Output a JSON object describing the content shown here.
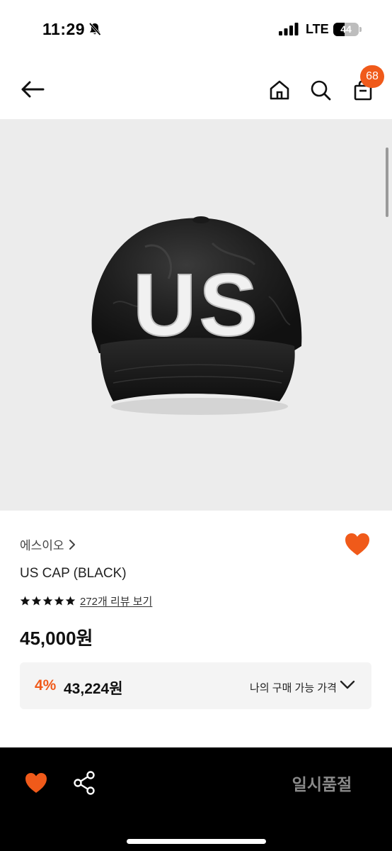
{
  "status_bar": {
    "time": "11:29",
    "network": "LTE",
    "battery_level": "44",
    "battery_fraction": 0.44,
    "icons": [
      "bell-muted-icon",
      "signal-icon",
      "battery-icon"
    ]
  },
  "header": {
    "icons": [
      "back-arrow-icon",
      "home-icon",
      "search-icon",
      "cart-icon"
    ],
    "cart_count": "68"
  },
  "gallery": {
    "cap_lettering": "US",
    "background": "#ececec"
  },
  "product": {
    "brand": "에스이오",
    "title": "US CAP (BLACK)",
    "rating_stars": 5,
    "review_link": "272개 리뷰 보기",
    "price": "45,000원",
    "discount": {
      "rate": "4%",
      "price": "43,224원",
      "label": "나의 구매 가능 가격"
    }
  },
  "bottom_bar": {
    "icons": [
      "heart-icon",
      "share-icon"
    ],
    "soldout_label": "일시품절"
  },
  "colors": {
    "accent": "#f05a1a",
    "bottom_bar": "#000000",
    "muted_text": "#8a8a8a"
  }
}
